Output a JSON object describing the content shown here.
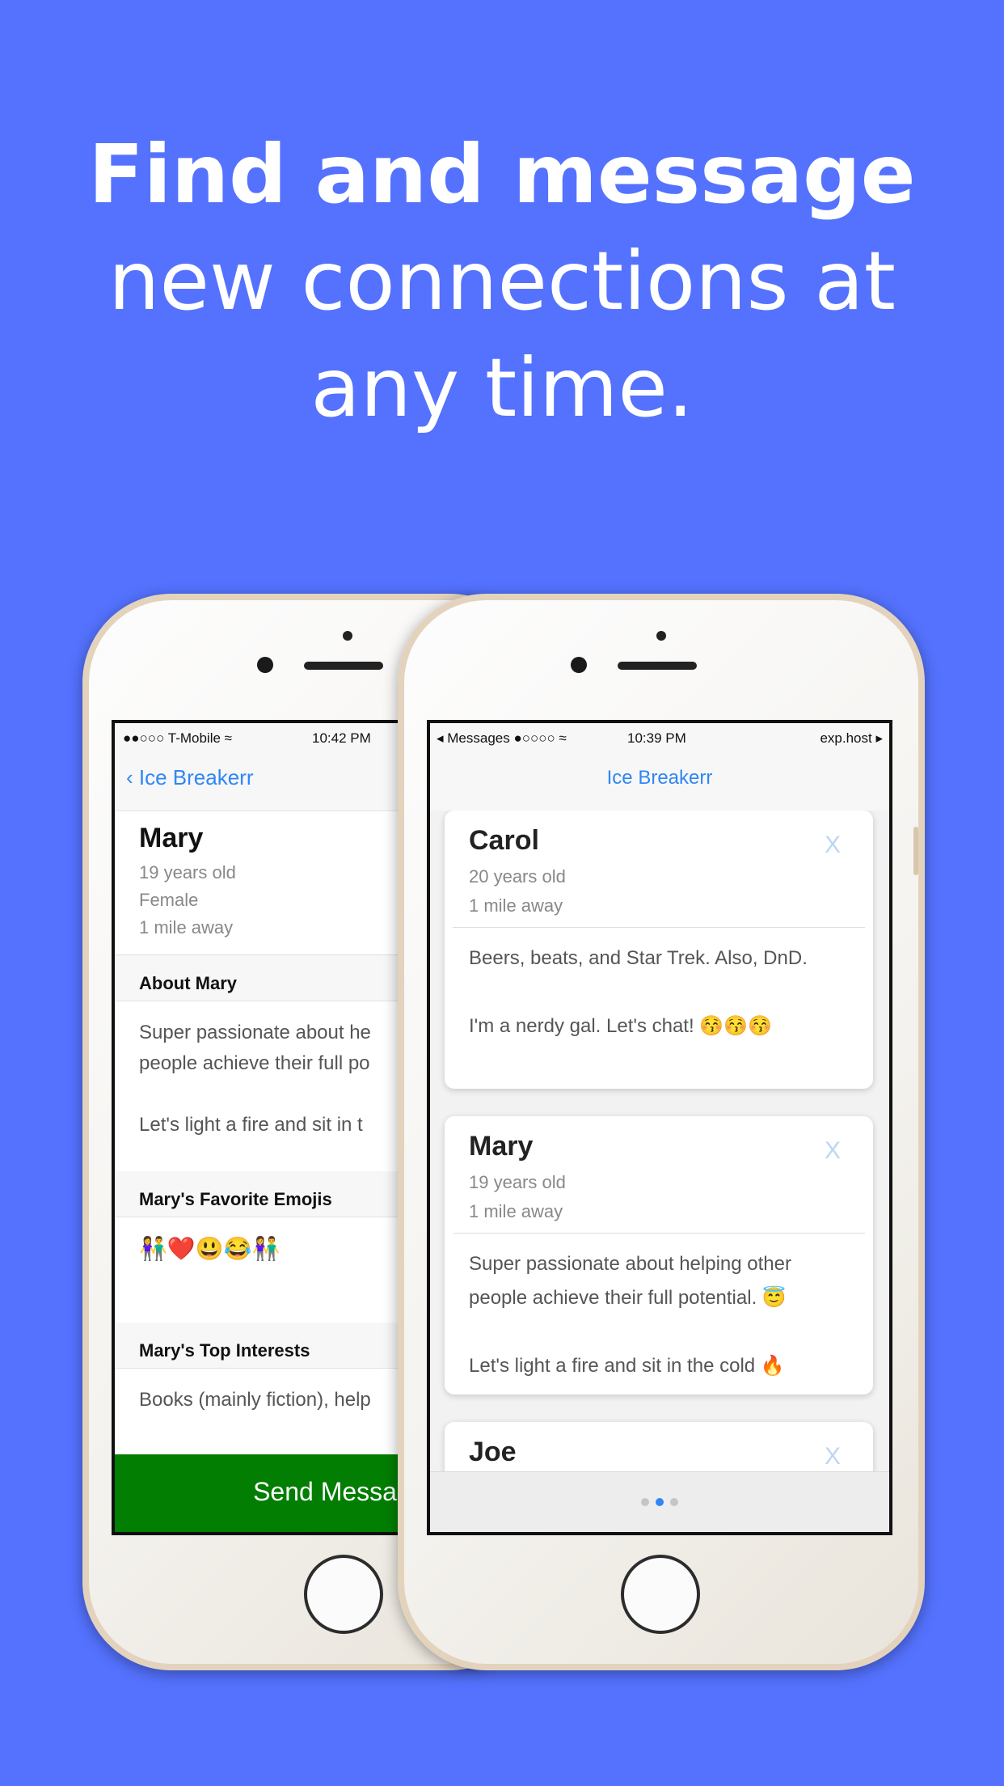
{
  "headline": {
    "line1": "Find and message",
    "line2": "new connections at",
    "line3": "any time."
  },
  "back_phone": {
    "status": {
      "carrier": "●●○○○ T-Mobile ≈",
      "time": "10:42 PM"
    },
    "nav": {
      "back_label": "‹ Ice Breakerr"
    },
    "profile": {
      "name": "Mary",
      "age": "19 years old",
      "gender": "Female",
      "distance": "1 mile away"
    },
    "about_header": "About Mary",
    "about_text": "Super passionate about he\npeople achieve their full po\n\nLet's light a fire and sit in t",
    "emojis_header": "Mary's Favorite Emojis",
    "emojis": "👫❤️😃😂👫",
    "interests_header": "Mary's Top Interests",
    "interests_text": "Books (mainly fiction), help",
    "send_button": "Send Messa"
  },
  "front_phone": {
    "status": {
      "left": "◂ Messages ●○○○○ ≈",
      "time": "10:39 PM",
      "right": "exp.host ▸"
    },
    "nav_title": "Ice Breakerr",
    "cards": [
      {
        "name": "Carol",
        "close": "X",
        "meta": "20 years old\n1 mile away",
        "bio": "Beers, beats, and Star Trek. Also, DnD.\n\nI'm a nerdy gal. Let's chat! 😚😚😚"
      },
      {
        "name": "Mary",
        "close": "X",
        "meta": "19 years old\n1 mile away",
        "bio": "Super passionate about helping other\npeople achieve their full potential. 😇\n\nLet's light a fire and sit in the cold 🔥"
      },
      {
        "name": "Joe",
        "close": "X",
        "meta": "",
        "bio": ""
      }
    ]
  }
}
